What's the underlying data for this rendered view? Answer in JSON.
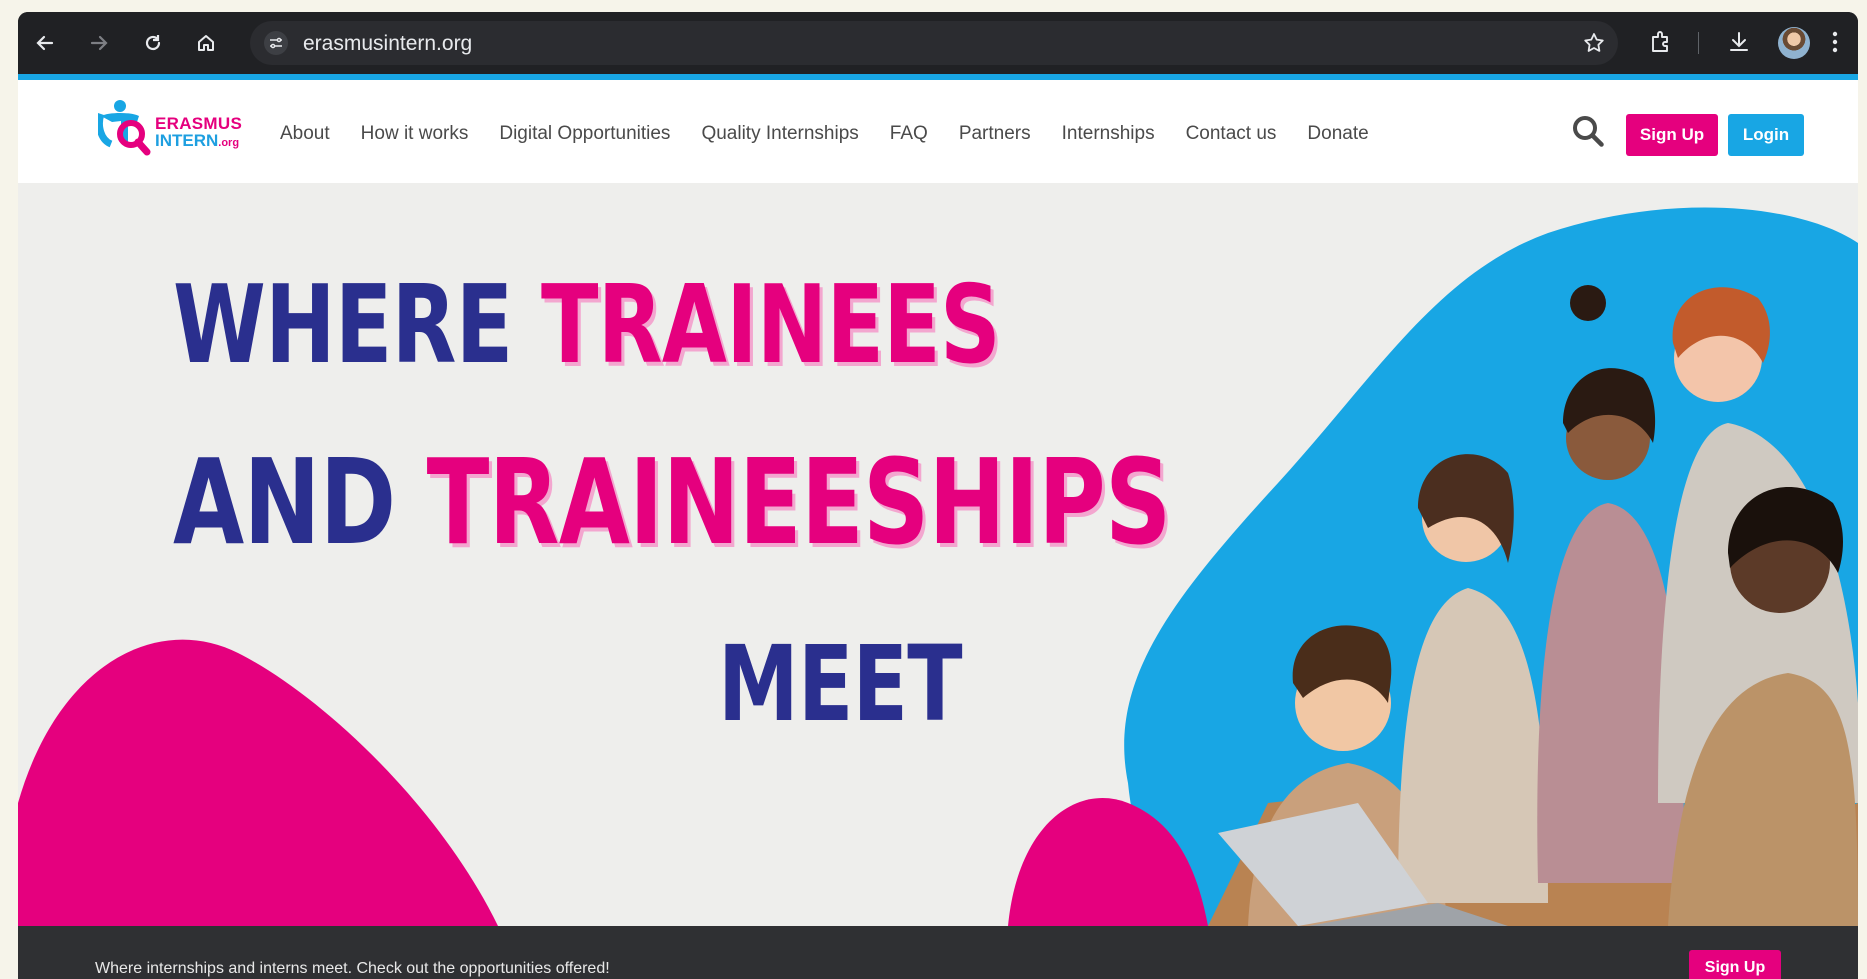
{
  "browser": {
    "url": "erasmusintern.org"
  },
  "logo": {
    "line1": "ERASMUS",
    "line2": "INTERN",
    "suffix": ".org"
  },
  "nav": {
    "items": [
      "About",
      "How it works",
      "Digital Opportunities",
      "Quality Internships",
      "FAQ",
      "Partners",
      "Internships",
      "Contact us",
      "Donate"
    ]
  },
  "header": {
    "signup_label": "Sign Up",
    "login_label": "Login"
  },
  "hero": {
    "line1_a": "WHERE",
    "line1_b": "TRAINEES",
    "line2_a": "AND",
    "line2_b": "TRAINEESHIPS",
    "line3": "MEET"
  },
  "strip": {
    "text": "Where internships and interns meet. Check out the opportunities offered!",
    "signup_label": "Sign Up"
  },
  "colors": {
    "pink": "#e5007e",
    "blue": "#18a6e4",
    "navy": "#2a2f8e"
  }
}
